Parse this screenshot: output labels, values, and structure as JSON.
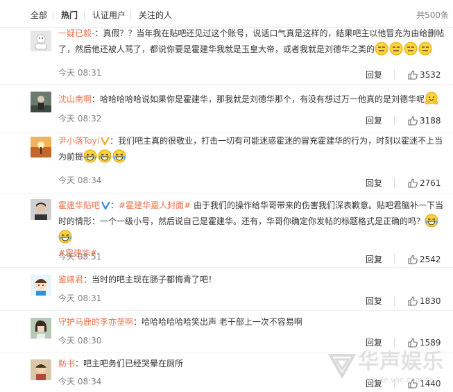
{
  "tabs": {
    "all": "全部",
    "hot": "热门",
    "verified": "认证用户",
    "following": "关注的人",
    "total": "共500条"
  },
  "actions": {
    "reply": "回复"
  },
  "comments": [
    {
      "user": "一疑已毅-",
      "sep": "：",
      "text": "真假？？当年我在贴吧还见过这个账号，说话口气真是这样的，结果吧主以他冒充为由给删帖了，然后他还被人骂了，都说你要是霍建华我就是玉皇大帝，或者我就是刘德华之类的",
      "time": "今天 08:31",
      "likes": "3532"
    },
    {
      "user": "沈山南啊",
      "sep": "：",
      "text": "哈哈哈哈哈说如果你是霍建华，那我就是刘德华那个，有没有想过万一他真的是刘德华呢",
      "time": "今天 08:32",
      "likes": "3188"
    },
    {
      "user": "尹小落Toyi",
      "sep": "：",
      "text": "我们吧主真的很敬业，打击一切有可能迷惑霍迷的冒充霍建华的行为，时刻以霍迷不上当为前提",
      "time": "今天 08:34",
      "likes": "2761"
    },
    {
      "user": "霍建华贴吧",
      "sep": "：",
      "topic": "#霍建华嘉人封面#",
      "text": " 由于我们的操作给华哥带来的伤害我们深表歉意。贴吧君脑补一下当时的情形：一个一级小号，然后说自己是霍建华。还有，华哥你确定你发帖的标题格式是正确的吗？",
      "topic2": "#霍建华#",
      "time": "今天 08:51",
      "likes": "2542"
    },
    {
      "user": "鉴婊君",
      "sep": "：",
      "text": "当时的吧主现在肠子都悔青了吧！",
      "time": "今天 08:31",
      "likes": "1830"
    },
    {
      "user": "守护马鹿的李亦垄啊",
      "sep": "：",
      "text": "哈哈哈哈哈哈笑出声 老干部上一次不容易啊",
      "time": "今天 08:30",
      "likes": "1589"
    },
    {
      "user": "鲂书",
      "sep": "：",
      "text": "吧主吧务们已经哭晕在厕所",
      "time": "今天 08:34",
      "likes": "1440"
    }
  ],
  "watermark": {
    "brand": "华声娱乐",
    "url": "yule.voc.com.cn"
  },
  "colors": {
    "username": "#eb7350",
    "meta": "#808080",
    "text": "#333333",
    "verified": "#2e8be4"
  }
}
